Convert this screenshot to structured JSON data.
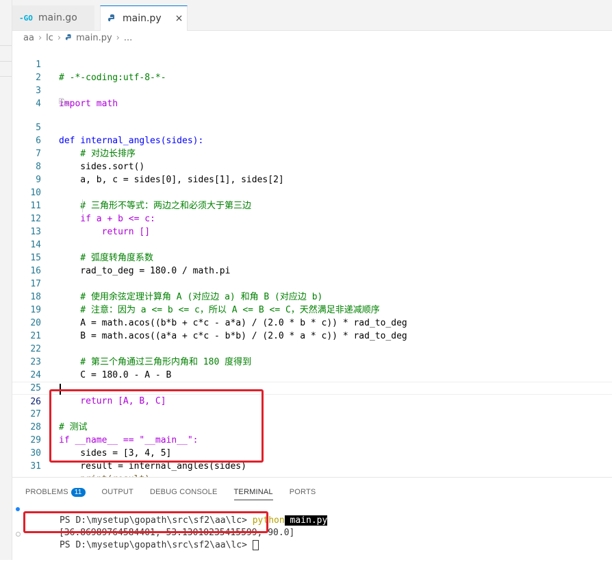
{
  "tabs": [
    {
      "label": "main.go",
      "icon": "go-icon",
      "active": false
    },
    {
      "label": "main.py",
      "icon": "python-icon",
      "active": true,
      "close": "×"
    }
  ],
  "breadcrumb": [
    "aa",
    "lc",
    "main.py",
    "..."
  ],
  "editor": {
    "codelens": "⎘⌄",
    "lines": [
      {
        "n": "1",
        "text": "# -*-coding:utf-8-*-"
      },
      {
        "n": "2",
        "text": ""
      },
      {
        "n": "3",
        "text": "import math"
      },
      {
        "n": "4",
        "text": ""
      },
      {
        "n": "5",
        "text": "def internal_angles(sides):"
      },
      {
        "n": "6",
        "text": "    # 对边长排序"
      },
      {
        "n": "7",
        "text": "    sides.sort()"
      },
      {
        "n": "8",
        "text": "    a, b, c = sides[0], sides[1], sides[2]"
      },
      {
        "n": "9",
        "text": ""
      },
      {
        "n": "10",
        "text": "    # 三角形不等式：两边之和必须大于第三边"
      },
      {
        "n": "11",
        "text": "    if a + b <= c:"
      },
      {
        "n": "12",
        "text": "        return []"
      },
      {
        "n": "13",
        "text": ""
      },
      {
        "n": "14",
        "text": "    # 弧度转角度系数"
      },
      {
        "n": "15",
        "text": "    rad_to_deg = 180.0 / math.pi"
      },
      {
        "n": "16",
        "text": ""
      },
      {
        "n": "17",
        "text": "    # 使用余弦定理计算角 A (对应边 a) 和角 B (对应边 b)"
      },
      {
        "n": "18",
        "text": "    # 注意：因为 a <= b <= c，所以 A <= B <= C，天然满足非递减顺序"
      },
      {
        "n": "19",
        "text": "    A = math.acos((b*b + c*c - a*a) / (2.0 * b * c)) * rad_to_deg"
      },
      {
        "n": "20",
        "text": "    B = math.acos((a*a + c*c - b*b) / (2.0 * a * c)) * rad_to_deg"
      },
      {
        "n": "21",
        "text": ""
      },
      {
        "n": "22",
        "text": "    # 第三个角通过三角形内角和 180 度得到"
      },
      {
        "n": "23",
        "text": "    C = 180.0 - A - B"
      },
      {
        "n": "24",
        "text": ""
      },
      {
        "n": "25",
        "text": "    return [A, B, C]"
      },
      {
        "n": "26",
        "text": ""
      },
      {
        "n": "27",
        "text": "# 测试"
      },
      {
        "n": "28",
        "text": "if __name__ == \"__main__\":"
      },
      {
        "n": "29",
        "text": "    sides = [3, 4, 5]"
      },
      {
        "n": "30",
        "text": "    result = internal_angles(sides)"
      },
      {
        "n": "31",
        "text": "    print(result)"
      }
    ]
  },
  "panel": {
    "tabs": [
      {
        "label": "PROBLEMS",
        "badge": "11"
      },
      {
        "label": "OUTPUT"
      },
      {
        "label": "DEBUG CONSOLE"
      },
      {
        "label": "TERMINAL",
        "active": true
      },
      {
        "label": "PORTS"
      }
    ],
    "terminal": {
      "prompt1": "PS D:\\mysetup\\gopath\\src\\sf2\\aa\\lc> ",
      "cmd_word": "python",
      "cmd_arg": " main.py",
      "output": "[36.86989764584401, 53.13010235415599, 90.0]",
      "prompt2": "PS D:\\mysetup\\gopath\\src\\sf2\\aa\\lc> "
    }
  },
  "colors": {
    "highlight_box": "#e0202a",
    "accent": "#0078d4"
  }
}
